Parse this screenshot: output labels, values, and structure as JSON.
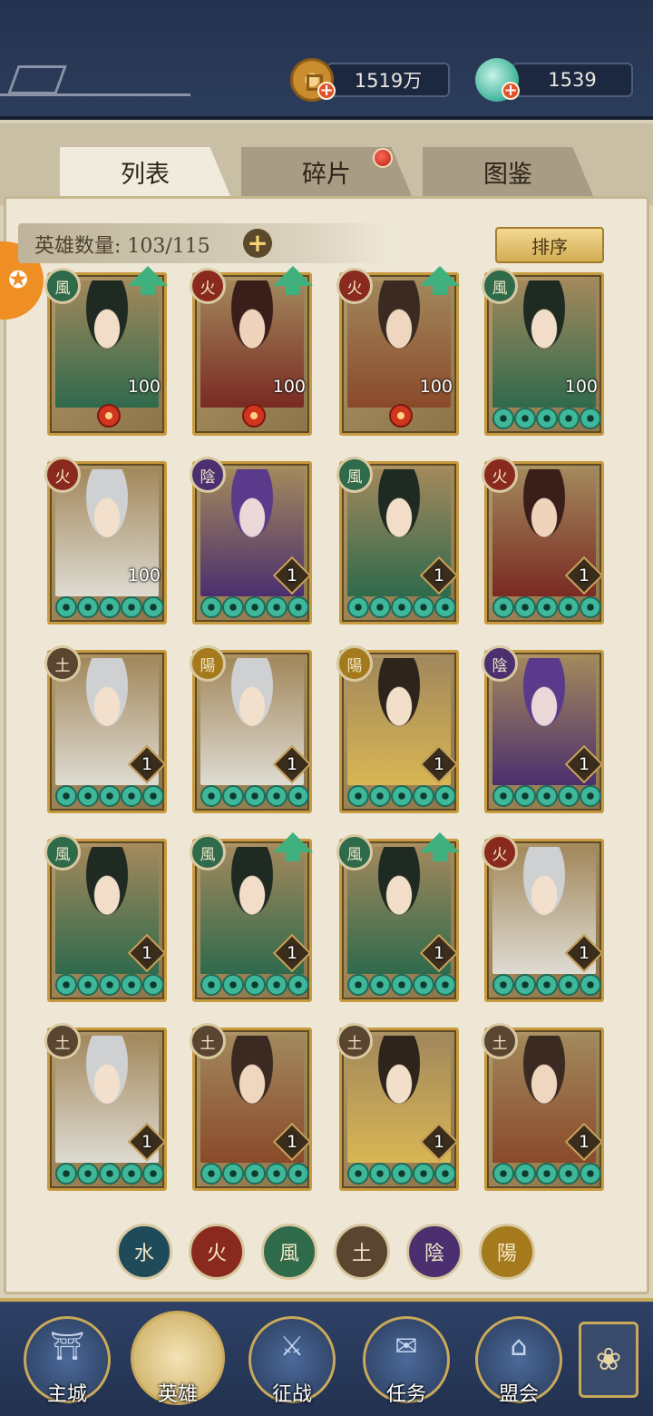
{
  "currency": {
    "coins": "1519万",
    "jade": "1539"
  },
  "tabs": [
    {
      "label": "列表",
      "active": true
    },
    {
      "label": "碎片",
      "active": false,
      "has_notice": true
    },
    {
      "label": "图鉴",
      "active": false
    }
  ],
  "hero_count": "英雄数量: 103/115",
  "sort_label": "排序",
  "elements": {
    "wind": "風",
    "fire": "火",
    "earth": "土",
    "yin": "陰",
    "yang": "陽",
    "water": "水"
  },
  "heroes": [
    {
      "element": "風",
      "elem_color": "#2f6a4a",
      "level": "100",
      "diamond": false,
      "upgrade": true,
      "fire_mark": true,
      "tint": "c-green"
    },
    {
      "element": "火",
      "elem_color": "#8a2a1e",
      "level": "100",
      "diamond": false,
      "upgrade": true,
      "fire_mark": true,
      "tint": "c-red"
    },
    {
      "element": "火",
      "elem_color": "#8a2a1e",
      "level": "100",
      "diamond": false,
      "upgrade": true,
      "fire_mark": true,
      "tint": "c-brown"
    },
    {
      "element": "風",
      "elem_color": "#2f6a4a",
      "level": "100",
      "diamond": false,
      "upgrade": false,
      "fire_mark": false,
      "tint": "c-green"
    },
    {
      "element": "火",
      "elem_color": "#8a2a1e",
      "level": "100",
      "diamond": false,
      "upgrade": false,
      "fire_mark": false,
      "tint": "c-white"
    },
    {
      "element": "陰",
      "elem_color": "#4b2f6e",
      "level": "1",
      "diamond": true,
      "upgrade": false,
      "fire_mark": false,
      "tint": "c-purple"
    },
    {
      "element": "風",
      "elem_color": "#2f6a4a",
      "level": "1",
      "diamond": true,
      "upgrade": false,
      "fire_mark": false,
      "tint": "c-green"
    },
    {
      "element": "火",
      "elem_color": "#8a2a1e",
      "level": "1",
      "diamond": true,
      "upgrade": false,
      "fire_mark": false,
      "tint": "c-red"
    },
    {
      "element": "土",
      "elem_color": "#5a4630",
      "level": "1",
      "diamond": true,
      "upgrade": false,
      "fire_mark": false,
      "tint": "c-white"
    },
    {
      "element": "陽",
      "elem_color": "#a57a1c",
      "level": "1",
      "diamond": true,
      "upgrade": false,
      "fire_mark": false,
      "tint": "c-white"
    },
    {
      "element": "陽",
      "elem_color": "#a57a1c",
      "level": "1",
      "diamond": true,
      "upgrade": false,
      "fire_mark": false,
      "tint": "c-gold"
    },
    {
      "element": "陰",
      "elem_color": "#4b2f6e",
      "level": "1",
      "diamond": true,
      "upgrade": false,
      "fire_mark": false,
      "tint": "c-purple"
    },
    {
      "element": "風",
      "elem_color": "#2f6a4a",
      "level": "1",
      "diamond": true,
      "upgrade": false,
      "fire_mark": false,
      "tint": "c-green"
    },
    {
      "element": "風",
      "elem_color": "#2f6a4a",
      "level": "1",
      "diamond": true,
      "upgrade": true,
      "fire_mark": false,
      "tint": "c-green"
    },
    {
      "element": "風",
      "elem_color": "#2f6a4a",
      "level": "1",
      "diamond": true,
      "upgrade": true,
      "fire_mark": false,
      "tint": "c-green"
    },
    {
      "element": "火",
      "elem_color": "#8a2a1e",
      "level": "1",
      "diamond": true,
      "upgrade": false,
      "fire_mark": false,
      "tint": "c-white"
    },
    {
      "element": "土",
      "elem_color": "#5a4630",
      "level": "1",
      "diamond": true,
      "upgrade": false,
      "fire_mark": false,
      "tint": "c-white"
    },
    {
      "element": "土",
      "elem_color": "#5a4630",
      "level": "1",
      "diamond": true,
      "upgrade": false,
      "fire_mark": false,
      "tint": "c-brown"
    },
    {
      "element": "土",
      "elem_color": "#5a4630",
      "level": "1",
      "diamond": true,
      "upgrade": false,
      "fire_mark": false,
      "tint": "c-gold"
    },
    {
      "element": "土",
      "elem_color": "#5a4630",
      "level": "1",
      "diamond": true,
      "upgrade": false,
      "fire_mark": false,
      "tint": "c-brown"
    }
  ],
  "filters": [
    {
      "label": "水",
      "color": "#1e4a5a"
    },
    {
      "label": "火",
      "color": "#8a2a1e"
    },
    {
      "label": "風",
      "color": "#2f6a4a"
    },
    {
      "label": "土",
      "color": "#5a4630"
    },
    {
      "label": "陰",
      "color": "#4b2f6e"
    },
    {
      "label": "陽",
      "color": "#a57a1c"
    }
  ],
  "nav": [
    {
      "label": "主城",
      "icon": "city-gate-icon"
    },
    {
      "label": "英雄",
      "icon": "hero-portrait-icon",
      "active": true
    },
    {
      "label": "征战",
      "icon": "battle-drum-icon"
    },
    {
      "label": "任务",
      "icon": "scroll-icon"
    },
    {
      "label": "盟会",
      "icon": "guild-hall-icon"
    }
  ],
  "side_badge_icon": "activity-swirl-icon",
  "nav_right_icon": "flower-menu-icon"
}
